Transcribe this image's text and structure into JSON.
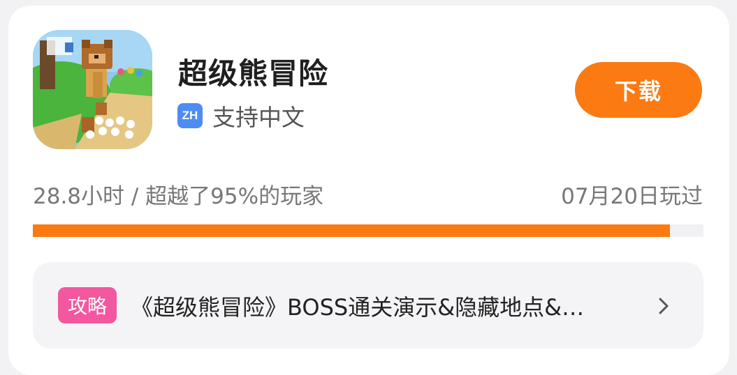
{
  "game": {
    "title": "超级熊冒险",
    "language_badge": "ZH",
    "language_text": "支持中文",
    "download_label": "下载"
  },
  "stats": {
    "play_summary": "28.8小时 / 超越了95%的玩家",
    "last_played": "07月20日玩过",
    "progress_fraction": 0.95
  },
  "guide": {
    "tag": "攻略",
    "title": "《超级熊冒险》BOSS通关演示&隐藏地点&…"
  },
  "colors": {
    "accent": "#fb7a12",
    "tag_pink": "#f2579f",
    "badge_blue": "#4d8cf5"
  },
  "icons": {
    "chevron": "chevron-right-icon"
  }
}
